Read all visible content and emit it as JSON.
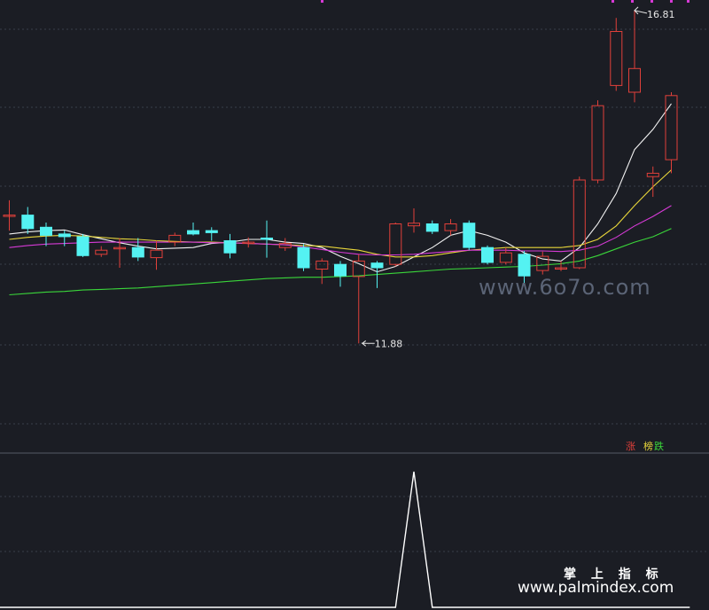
{
  "colors": {
    "background": "#1b1d24",
    "grid": "#3a3f4a",
    "up": "#e0403a",
    "down": "#54f2f2",
    "ma5": "#f2f2f2",
    "ma10": "#e8d63a",
    "ma20": "#d63ad6",
    "ma60": "#3ad63a",
    "indicator": "#ffffff",
    "marker": "#d63ad6"
  },
  "annotations": {
    "high": "16.81",
    "low": "11.88"
  },
  "legend": {
    "up": "涨",
    "rank": "榜",
    "down": "跌"
  },
  "watermarks": {
    "site1": "www.6o7o.com",
    "brand": "掌 上 指 标",
    "site2": "www.palmindex.com"
  },
  "chart_data": [
    {
      "type": "candlestick",
      "title": "",
      "ylim": [
        10.4,
        16.9
      ],
      "grid": true,
      "high_label": "16.81",
      "low_label": "11.88",
      "candles": [
        {
          "o": 13.78,
          "c": 13.78,
          "h": 14.0,
          "l": 13.55
        },
        {
          "o": 13.78,
          "c": 13.58,
          "h": 13.9,
          "l": 13.5
        },
        {
          "o": 13.6,
          "c": 13.48,
          "h": 13.67,
          "l": 13.32
        },
        {
          "o": 13.5,
          "c": 13.46,
          "h": 13.55,
          "l": 13.32
        },
        {
          "o": 13.46,
          "c": 13.18,
          "h": 13.5,
          "l": 13.16
        },
        {
          "o": 13.2,
          "c": 13.26,
          "h": 13.32,
          "l": 13.16
        },
        {
          "o": 13.3,
          "c": 13.3,
          "h": 13.44,
          "l": 13.0
        },
        {
          "o": 13.3,
          "c": 13.16,
          "h": 13.44,
          "l": 13.1
        },
        {
          "o": 13.15,
          "c": 13.26,
          "h": 13.4,
          "l": 12.97
        },
        {
          "o": 13.38,
          "c": 13.48,
          "h": 13.52,
          "l": 13.32
        },
        {
          "o": 13.55,
          "c": 13.5,
          "h": 13.67,
          "l": 13.48
        },
        {
          "o": 13.55,
          "c": 13.52,
          "h": 13.6,
          "l": 13.4
        },
        {
          "o": 13.4,
          "c": 13.22,
          "h": 13.5,
          "l": 13.14
        },
        {
          "o": 13.38,
          "c": 13.38,
          "h": 13.45,
          "l": 13.3
        },
        {
          "o": 13.44,
          "c": 13.42,
          "h": 13.7,
          "l": 13.15
        },
        {
          "o": 13.3,
          "c": 13.36,
          "h": 13.44,
          "l": 13.25
        },
        {
          "o": 13.3,
          "c": 13.0,
          "h": 13.35,
          "l": 12.95
        },
        {
          "o": 12.98,
          "c": 13.1,
          "h": 13.14,
          "l": 12.76
        },
        {
          "o": 13.05,
          "c": 12.88,
          "h": 13.1,
          "l": 12.72
        },
        {
          "o": 12.87,
          "c": 13.1,
          "h": 13.2,
          "l": 11.88
        },
        {
          "o": 13.07,
          "c": 13.0,
          "h": 13.1,
          "l": 12.7
        },
        {
          "o": 13.05,
          "c": 13.65,
          "h": 13.67,
          "l": 13.02
        },
        {
          "o": 13.62,
          "c": 13.66,
          "h": 13.88,
          "l": 13.52
        },
        {
          "o": 13.65,
          "c": 13.54,
          "h": 13.7,
          "l": 13.5
        },
        {
          "o": 13.55,
          "c": 13.65,
          "h": 13.72,
          "l": 13.48
        },
        {
          "o": 13.66,
          "c": 13.3,
          "h": 13.7,
          "l": 13.26
        },
        {
          "o": 13.3,
          "c": 13.08,
          "h": 13.33,
          "l": 13.05
        },
        {
          "o": 13.08,
          "c": 13.22,
          "h": 13.3,
          "l": 13.05
        },
        {
          "o": 13.2,
          "c": 12.88,
          "h": 13.25,
          "l": 12.76
        },
        {
          "o": 12.96,
          "c": 13.17,
          "h": 13.24,
          "l": 12.9
        },
        {
          "o": 13.0,
          "c": 13.0,
          "h": 13.1,
          "l": 12.95
        },
        {
          "o": 13.0,
          "c": 14.3,
          "h": 14.35,
          "l": 12.98
        },
        {
          "o": 14.3,
          "c": 15.4,
          "h": 15.48,
          "l": 14.25
        },
        {
          "o": 15.7,
          "c": 16.5,
          "h": 16.7,
          "l": 15.62
        },
        {
          "o": 15.6,
          "c": 15.95,
          "h": 16.81,
          "l": 15.45
        },
        {
          "o": 14.35,
          "c": 14.4,
          "h": 14.5,
          "l": 14.05
        },
        {
          "o": 14.6,
          "c": 15.55,
          "h": 15.6,
          "l": 14.4
        }
      ],
      "moving_averages": [
        {
          "name": "MA5",
          "color": "#f2f2f2",
          "values": [
            13.5,
            13.53,
            13.55,
            13.56,
            13.49,
            13.43,
            13.37,
            13.32,
            13.28,
            13.29,
            13.3,
            13.36,
            13.38,
            13.42,
            13.42,
            13.38,
            13.36,
            13.3,
            13.17,
            13.06,
            12.94,
            13.02,
            13.16,
            13.3,
            13.48,
            13.55,
            13.48,
            13.38,
            13.22,
            13.13,
            13.1,
            13.3,
            13.65,
            14.1,
            14.75,
            15.05,
            15.43
          ]
        },
        {
          "name": "MA10",
          "color": "#e8d63a",
          "values": [
            13.42,
            13.45,
            13.47,
            13.48,
            13.47,
            13.45,
            13.43,
            13.42,
            13.4,
            13.39,
            13.38,
            13.38,
            13.37,
            13.36,
            13.35,
            13.34,
            13.33,
            13.32,
            13.29,
            13.26,
            13.2,
            13.16,
            13.16,
            13.18,
            13.22,
            13.26,
            13.28,
            13.3,
            13.3,
            13.3,
            13.3,
            13.33,
            13.42,
            13.62,
            13.92,
            14.2,
            14.45
          ]
        },
        {
          "name": "MA20",
          "color": "#d63ad6",
          "values": [
            13.3,
            13.33,
            13.35,
            13.36,
            13.37,
            13.38,
            13.38,
            13.38,
            13.38,
            13.38,
            13.38,
            13.37,
            13.37,
            13.36,
            13.35,
            13.34,
            13.31,
            13.27,
            13.23,
            13.2,
            13.19,
            13.19,
            13.2,
            13.22,
            13.24,
            13.26,
            13.26,
            13.26,
            13.25,
            13.25,
            13.24,
            13.26,
            13.32,
            13.45,
            13.62,
            13.76,
            13.92
          ]
        },
        {
          "name": "MA60",
          "color": "#3ad63a",
          "values": [
            12.6,
            12.62,
            12.64,
            12.65,
            12.67,
            12.68,
            12.69,
            12.7,
            12.72,
            12.74,
            12.76,
            12.78,
            12.8,
            12.82,
            12.84,
            12.85,
            12.86,
            12.86,
            12.87,
            12.88,
            12.9,
            12.92,
            12.94,
            12.96,
            12.98,
            12.99,
            13.0,
            13.01,
            13.02,
            13.04,
            13.06,
            13.1,
            13.18,
            13.28,
            13.38,
            13.46,
            13.58
          ]
        }
      ]
    },
    {
      "type": "line",
      "title": "",
      "ylim": [
        0,
        1
      ],
      "x": [
        0,
        21,
        22,
        23,
        37
      ],
      "values": [
        0,
        0,
        1,
        0,
        0
      ]
    }
  ]
}
